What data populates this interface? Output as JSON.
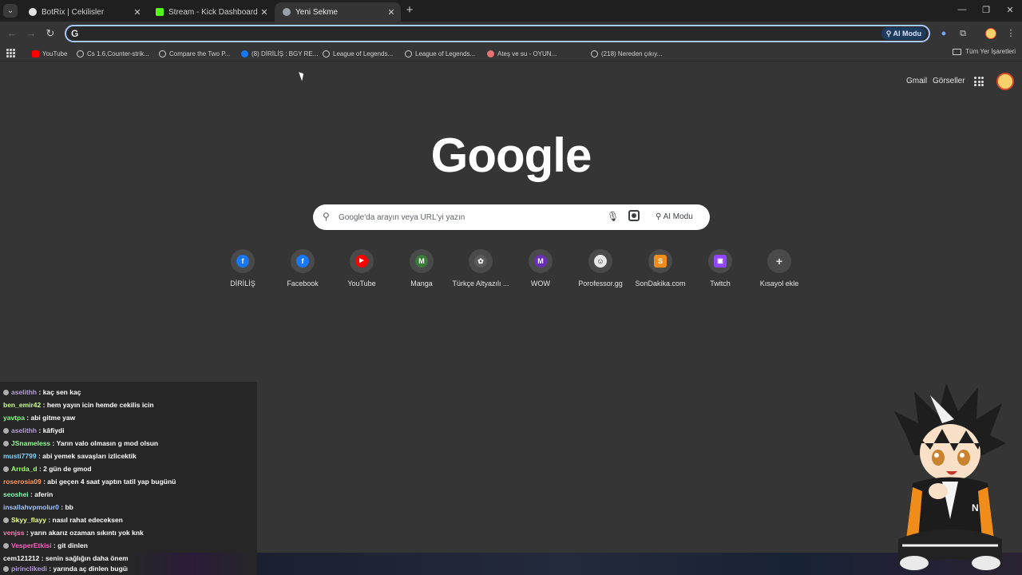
{
  "tabs": [
    {
      "title": "BotRix | Cekilisler",
      "favicon": "botrix-icon",
      "color": "#e3e3e3",
      "active": false
    },
    {
      "title": "Stream - Kick Dashboard",
      "favicon": "kick-icon",
      "color": "#53fc18",
      "active": false
    },
    {
      "title": "Yeni Sekme",
      "favicon": "chrome-icon",
      "color": "#9aa0a6",
      "active": true
    }
  ],
  "omnibox": {
    "value": "",
    "placeholder": "",
    "ai_label": "AI Modu"
  },
  "bookmarks": [
    {
      "label": "YouTube",
      "color": "#ff0000"
    },
    {
      "label": "Cs 1.6,Counter-strik...",
      "color": "#9aa0a6"
    },
    {
      "label": "Compare the Two P...",
      "color": "#9aa0a6"
    },
    {
      "label": "(8) DİRİLİŞ : BGY RE...",
      "color": "#1877f2"
    },
    {
      "label": "League of Legends...",
      "color": "#9aa0a6"
    },
    {
      "label": "League of Legends...",
      "color": "#9aa0a6"
    },
    {
      "label": "Ateş ve su - OYUN...",
      "color": "#e57373"
    },
    {
      "label": "(218) Nereden çıkıy...",
      "color": "#9aa0a6"
    }
  ],
  "bookmarks_all": "Tüm Yer İşaretleri",
  "ntp": {
    "gmail": "Gmail",
    "images": "Görseller",
    "logo": "Google",
    "search_placeholder": "Google'da arayın veya URL'yi yazın",
    "ai_mode": "AI Modu"
  },
  "shortcuts": [
    {
      "label": "DİRİLİŞ",
      "glyph": "f",
      "color": "#1877f2"
    },
    {
      "label": "Facebook",
      "glyph": "f",
      "color": "#1877f2"
    },
    {
      "label": "YouTube",
      "glyph": "▶",
      "color": "#ff0000"
    },
    {
      "label": "Manga",
      "glyph": "M",
      "color": "#3a7a3a"
    },
    {
      "label": "Türkçe Altyazılı ...",
      "glyph": "✿",
      "color": "#5a5a5a"
    },
    {
      "label": "WOW",
      "glyph": "M",
      "color": "#6b2fb5"
    },
    {
      "label": "Porofessor.gg",
      "glyph": "☺",
      "color": "#2b2b2b"
    },
    {
      "label": "SonDakika.com",
      "glyph": "S",
      "color": "#f08c1a"
    },
    {
      "label": "Twitch",
      "glyph": "▣",
      "color": "#9146ff"
    },
    {
      "label": "Kısayol ekle",
      "glyph": "+",
      "color": "#4a4a4a"
    }
  ],
  "chat": [
    {
      "user": "aselithh",
      "text": "kaç sen kaç",
      "color": "#b39ddb",
      "badge": true
    },
    {
      "user": "ben_emir42",
      "text": "hem yayın icin hemde cekilis icin",
      "color": "#c6ff8c",
      "badge": false
    },
    {
      "user": "yavtpa",
      "text": "abi gitme yaw",
      "color": "#7cff7c",
      "badge": false
    },
    {
      "user": "aselithh",
      "text": "kâfiydi",
      "color": "#b39ddb",
      "badge": true
    },
    {
      "user": "JSnameless",
      "text": "Yarın valo olmasın g mod olsun",
      "color": "#8cff8c",
      "badge": true
    },
    {
      "user": "musti7799",
      "text": "abi yemek savaşları izlicektik",
      "color": "#7fd4ff",
      "badge": false
    },
    {
      "user": "Arrda_d",
      "text": "2 gün de gmod",
      "color": "#9cff6e",
      "badge": true
    },
    {
      "user": "roserosia09",
      "text": "abi geçen 4 saat yaptın tatil yap bugünü",
      "color": "#ff9b5e",
      "badge": false
    },
    {
      "user": "seoshei",
      "text": "aferin",
      "color": "#7cffb0",
      "badge": false
    },
    {
      "user": "insallahvpmolur0",
      "text": "bb",
      "color": "#a1c4ff",
      "badge": false
    },
    {
      "user": "Skyy_flayy",
      "text": "nasıl rahat edeceksen",
      "color": "#e6ff8c",
      "badge": true
    },
    {
      "user": "venjss",
      "text": "yarın akarız ozaman sıkıntı yok knk",
      "color": "#ff7cb4",
      "badge": false
    },
    {
      "user": "VesperEtkisi",
      "text": "git dinlen",
      "color": "#ff5ec4",
      "badge": true
    },
    {
      "user": "cem121212",
      "text": "senin sağlığın daha önemli",
      "color": "#ffffff",
      "badge": false
    },
    {
      "user": "pirinclikedi",
      "text": "yarında aç dinlen bugün",
      "color": "#b39ddb",
      "badge": true
    }
  ]
}
